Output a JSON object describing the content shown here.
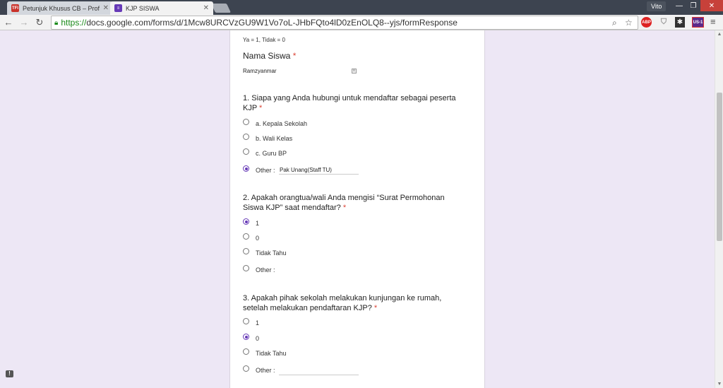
{
  "browser": {
    "tabs": [
      {
        "title": "Petunjuk Khusus CB – Prof",
        "favicon": "TFI"
      },
      {
        "title": "KJP SISWA",
        "favicon": "≡"
      }
    ],
    "profile": "Vito",
    "window_controls": {
      "minimize": "—",
      "maximize": "❐",
      "close": "✕"
    },
    "url_scheme": "https://",
    "url_rest": "docs.google.com/forms/d/1Mcw8URCVzGU9W1Vo7oL-JHbFQto4lD0zEnOLQ8--yjs/formResponse",
    "extensions": {
      "abp": "ABP",
      "us1": "US-1"
    }
  },
  "form": {
    "hint": "Ya = 1, Tidak = 0",
    "required_marker": "*",
    "name_field": {
      "label": "Nama Siswa",
      "value": "Ramzyanmar"
    },
    "questions": [
      {
        "title_line1": "1. Siapa yang Anda hubungi untuk mendaftar sebagai peserta",
        "title_line2": "KJP",
        "options": [
          "a. Kepala Sekolah",
          "b. Wali Kelas",
          "c. Guru BP"
        ],
        "other_label": "Other :",
        "other_value": "Pak Unang(Staff TU)",
        "selected": "other"
      },
      {
        "title_line1": "2. Apakah orangtua/wali Anda mengisi “Surat Permohonan",
        "title_line2": "Siswa KJP” saat mendaftar?",
        "options": [
          "1",
          "0",
          "Tidak Tahu"
        ],
        "other_label": "Other :",
        "other_value": "",
        "selected": "1"
      },
      {
        "title_line1": "3. Apakah pihak sekolah melakukan kunjungan ke rumah,",
        "title_line2": "setelah melakukan pendaftaran KJP?",
        "options": [
          "1",
          "0",
          "Tidak Tahu"
        ],
        "other_label": "Other :",
        "other_value": "",
        "selected": "0"
      }
    ]
  },
  "colors": {
    "accent": "#673ab7",
    "required": "#db4437",
    "page_bg": "#ede7f5"
  }
}
